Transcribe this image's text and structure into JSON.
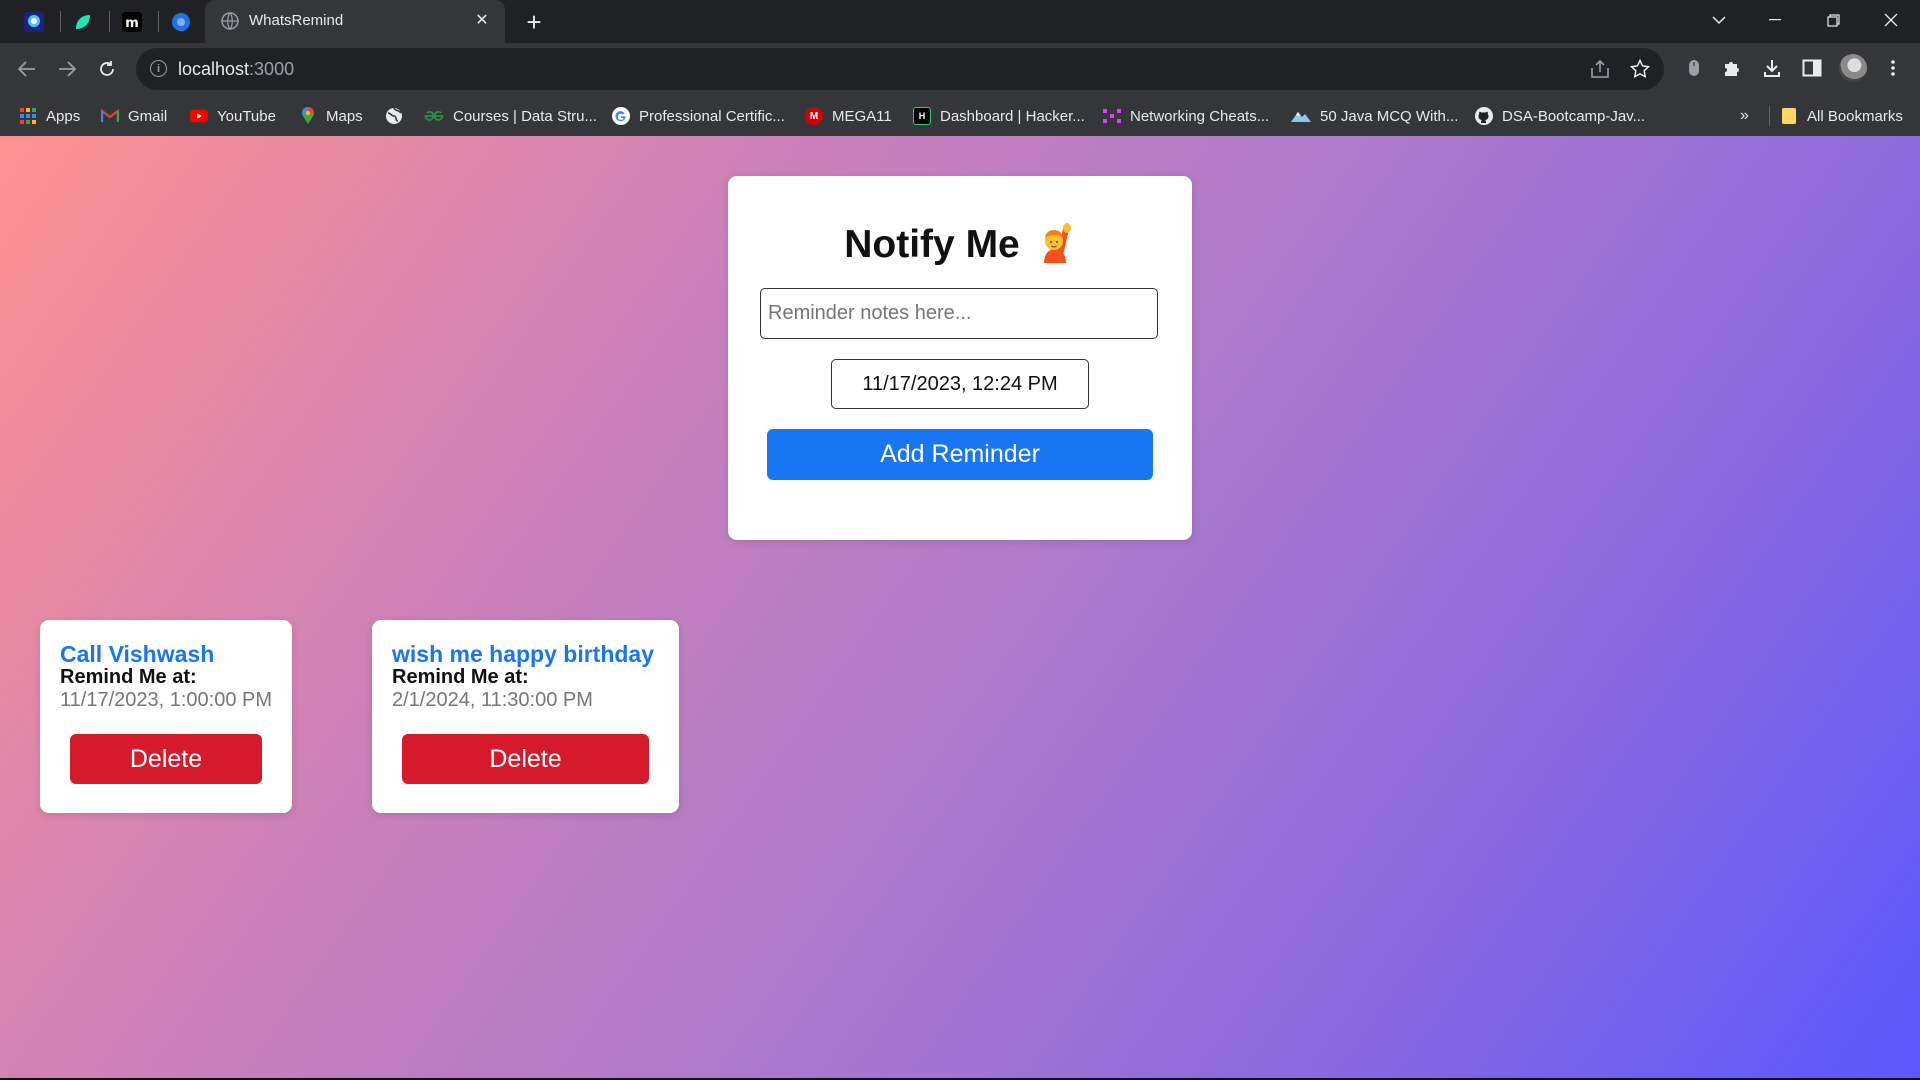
{
  "browser": {
    "tab_title": "WhatsRemind",
    "close_glyph": "✕",
    "newtab_glyph": "+",
    "url_host": "localhost",
    "url_port": ":3000"
  },
  "bookmarks": [
    {
      "label": "Apps",
      "icon": "apps-grid-icon"
    },
    {
      "label": "Gmail",
      "icon": "gmail-icon"
    },
    {
      "label": "YouTube",
      "icon": "youtube-icon"
    },
    {
      "label": "Maps",
      "icon": "maps-icon"
    },
    {
      "label": "",
      "icon": "globe-icon"
    },
    {
      "label": "Courses | Data Stru...",
      "icon": "gfg-icon"
    },
    {
      "label": "Professional Certific...",
      "icon": "google-icon"
    },
    {
      "label": "MEGA11",
      "icon": "mega11-icon"
    },
    {
      "label": "Dashboard | Hacker...",
      "icon": "hackerrank-icon"
    },
    {
      "label": "Networking Cheats...",
      "icon": "network-icon"
    },
    {
      "label": "50 Java MCQ With...",
      "icon": "mountain-icon"
    },
    {
      "label": "DSA-Bootcamp-Jav...",
      "icon": "github-icon"
    }
  ],
  "bookmarks_overflow": "»",
  "all_bookmarks": "All Bookmarks",
  "app": {
    "title": "Notify Me",
    "notes_placeholder": "Reminder notes here...",
    "datetime_value": "11/17/2023, 12:24 PM",
    "add_button": "Add Reminder"
  },
  "reminders": [
    {
      "title": "Call Vishwash",
      "label": "Remind Me at:",
      "time": "11/17/2023, 1:00:00 PM",
      "delete": "Delete"
    },
    {
      "title": "wish me happy birthday",
      "label": "Remind Me at:",
      "time": "2/1/2024, 11:30:00 PM",
      "delete": "Delete"
    }
  ],
  "colors": {
    "accent_blue": "#1976f2",
    "delete_red": "#d51b2b",
    "gradient_start": "#fe9192",
    "gradient_end": "#5a58fd"
  }
}
